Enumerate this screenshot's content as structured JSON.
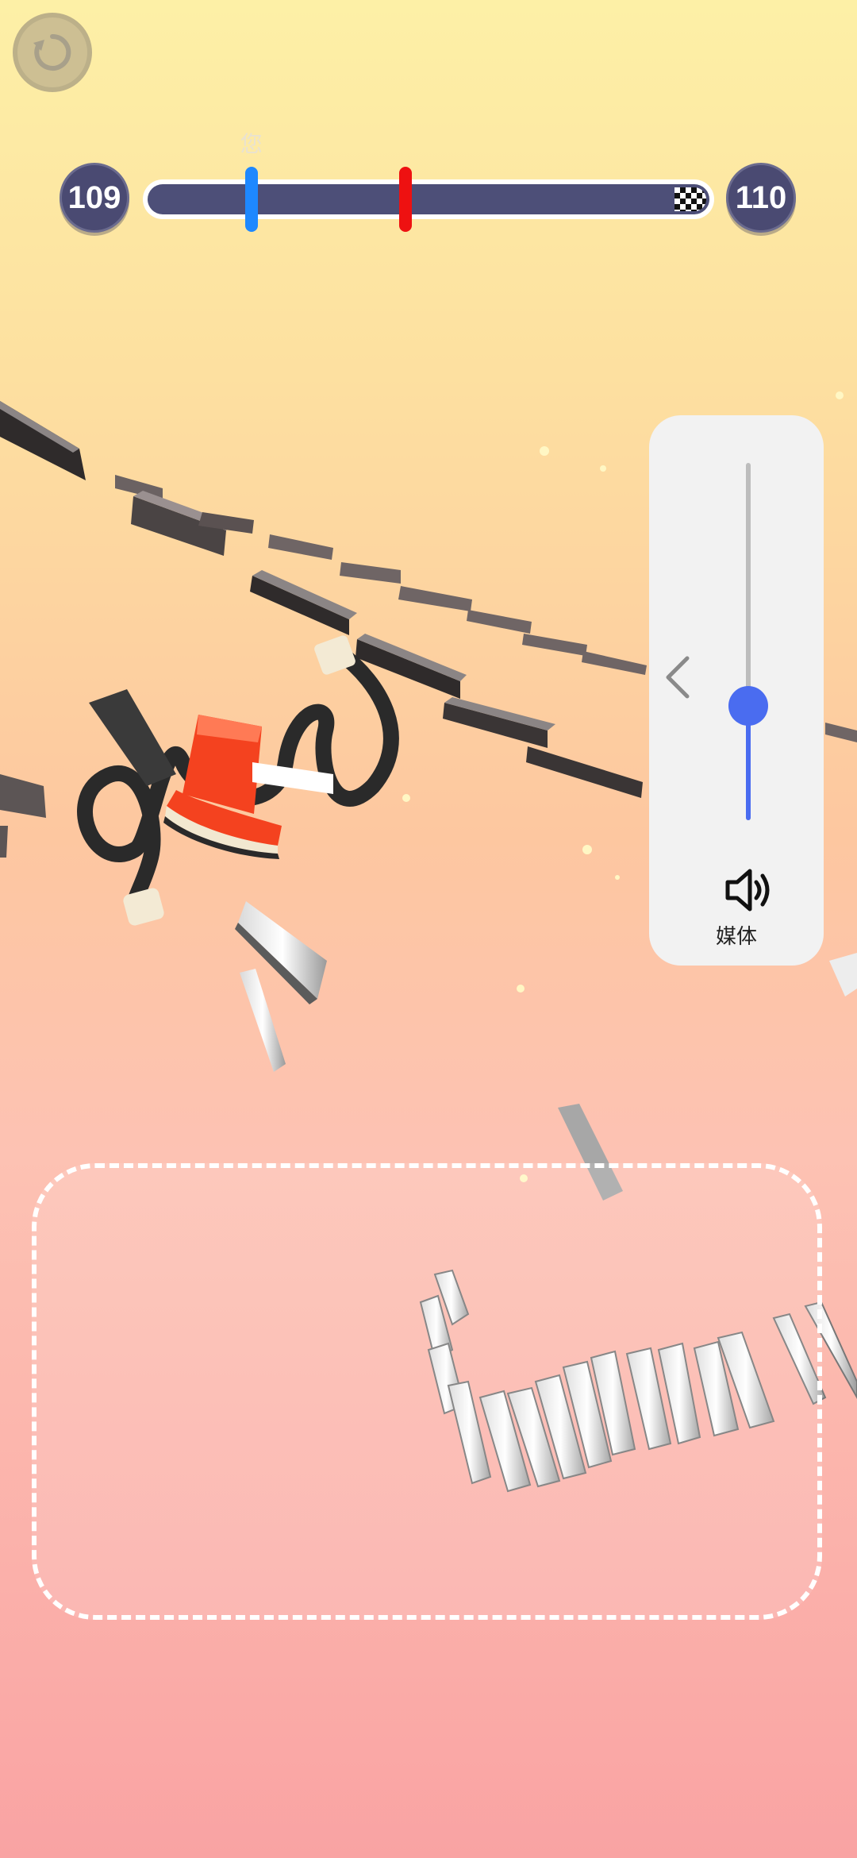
{
  "hud": {
    "restart_icon": "restart-icon",
    "current_level": "109",
    "next_level": "110",
    "player_label": "您",
    "player_progress": 0.19,
    "rival_progress": 0.46,
    "player_color": "#1e88ff",
    "rival_color": "#ee1111",
    "track_color": "#4d4f78"
  },
  "volume_panel": {
    "collapse_icon": "chevron-left-icon",
    "speaker_icon": "speaker-icon",
    "label": "媒体",
    "level": 0.32,
    "accent_color": "#4a6cf0"
  },
  "draw_area": {
    "border": "dashed"
  }
}
